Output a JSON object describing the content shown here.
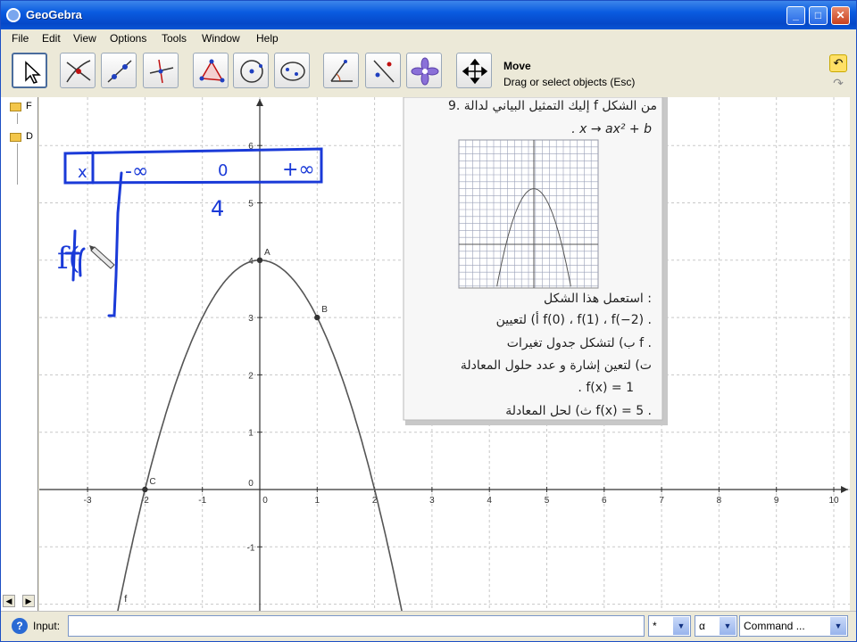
{
  "window": {
    "title": "GeoGebra",
    "minimize": "_",
    "maximize": "□",
    "close": "✕"
  },
  "menu": [
    "File",
    "Edit",
    "View",
    "Options",
    "Tools",
    "Window",
    "Help"
  ],
  "toolbar": {
    "tools": [
      "move",
      "intersect-lines",
      "line-through-points",
      "perpendicular-line",
      "polygon",
      "circle-center-point",
      "conic-five-points",
      "angle",
      "reflect-about-line",
      "slider-flower",
      "move-graphics-view"
    ],
    "selected_tool_name": "Move",
    "selected_tool_help": "Drag or select objects (Esc)"
  },
  "algebra_view": {
    "folders": [
      "F",
      "D"
    ]
  },
  "graphics": {
    "x_ticks": [
      "-3",
      "-2",
      "-1",
      "0",
      "1",
      "2",
      "3",
      "4",
      "5",
      "6",
      "7",
      "8",
      "9",
      "10"
    ],
    "y_ticks": [
      "6",
      "5",
      "4",
      "3",
      "2",
      "1",
      "0",
      "-1"
    ],
    "function_label": "f",
    "points": [
      {
        "label": "A",
        "x": 0,
        "y": 4
      },
      {
        "label": "B",
        "x": 1,
        "y": 3
      },
      {
        "label": "C",
        "x": -2,
        "y": 0
      }
    ],
    "function": {
      "a": -1,
      "b": 4
    },
    "handwriting": {
      "row_x": "x",
      "minus_inf": "-∞",
      "zero": "0",
      "plus_inf": "+∞",
      "four": "4",
      "f_of": "f("
    }
  },
  "exercise": {
    "number": "9.",
    "line1": "إليك التمثيل البياني لدالة f من الشكل",
    "line2": ". x → ax² + b",
    "line3": "استعمل هذا الشكل :",
    "line4": "أ) لتعيين f(0) ، f(1) ، f(−2) .",
    "line5": "ب) لتشكل جدول تغيرات f .",
    "line6": "ت) لتعين إشارة و عدد حلول المعادلة",
    "line7": ". f(x) = 1",
    "line8": "ث) لحل المعادلة f(x) = 5 ."
  },
  "input_bar": {
    "label": "Input:",
    "value": "",
    "symbols_combo": "*",
    "greek_combo": "α",
    "command_combo": "Command ..."
  },
  "colors": {
    "titlebar": "#0a5be0",
    "curve": "#555555",
    "ink": "#1a3ad8"
  }
}
